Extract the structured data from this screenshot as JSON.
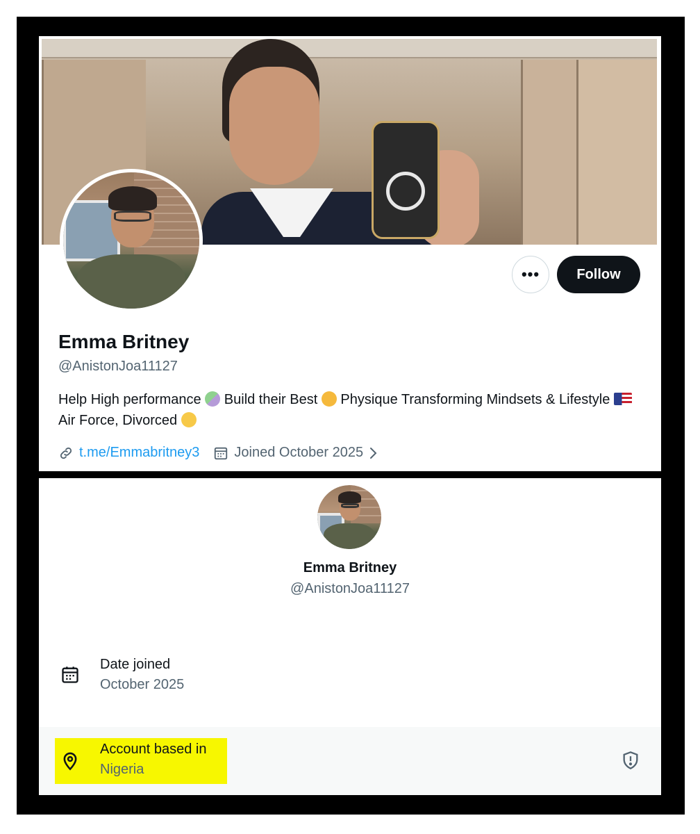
{
  "profile": {
    "name": "Emma Britney",
    "handle": "@AnistonJoa11127",
    "bio_part1": "Help High performance",
    "bio_part2": "Build their Best",
    "bio_part3": "Physique Transforming Mindsets & Lifestyle",
    "bio_part4": "Air Force, Divorced",
    "bio_emojis": [
      "performing-arts-emoji",
      "flexed-biceps-emoji",
      "us-flag-emoji",
      "pensive-face-emoji"
    ],
    "link": "t.me/Emmabritney3",
    "joined": "Joined October 2025"
  },
  "actions": {
    "more_label": "•••",
    "follow_label": "Follow"
  },
  "about": {
    "name": "Emma Britney",
    "handle": "@AnistonJoa11127",
    "date_joined_label": "Date joined",
    "date_joined_value": "October 2025",
    "based_in_label": "Account based in",
    "based_in_value": "Nigeria"
  },
  "colors": {
    "text_primary": "#0f1419",
    "text_secondary": "#536471",
    "link": "#1d9bf0",
    "highlight": "#f7f700",
    "frame": "#000000"
  },
  "icons": [
    "link-icon",
    "calendar-icon",
    "chevron-right-icon",
    "location-pin-icon",
    "shield-icon"
  ]
}
